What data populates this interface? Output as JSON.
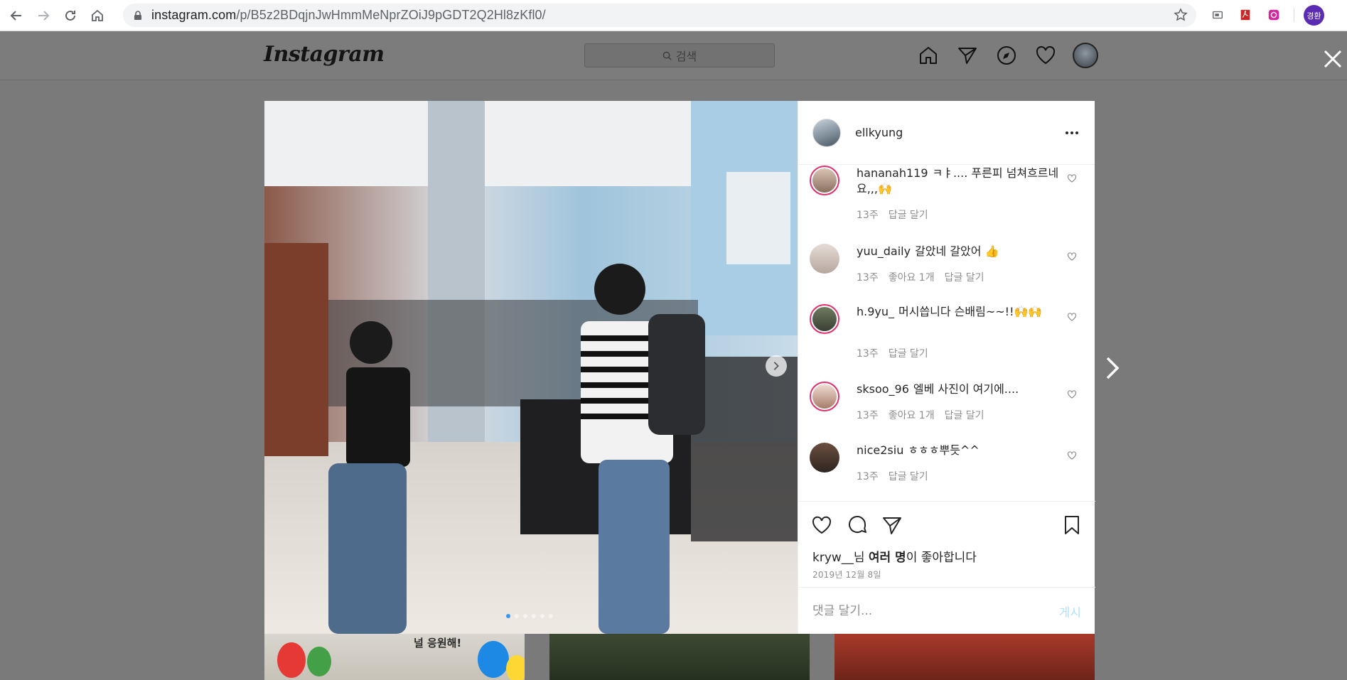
{
  "browser": {
    "url_host": "instagram.com",
    "url_path": "/p/B5z2BDqjnJwHmmMeNprZOiJ9pGDT2Q2Hl8zKfl0/",
    "profile_initials": "경환"
  },
  "topbar": {
    "logo": "Instagram",
    "search_placeholder": "검색"
  },
  "post": {
    "author": "ellkyung",
    "photo_count": 6,
    "active_photo_index": 0,
    "comments": [
      {
        "user": "hananah119",
        "text": "ㅋㅑ.... 푸른피 넘쳐흐르네요,,,🙌",
        "time": "13주",
        "likes": "",
        "reply": "답글 달기"
      },
      {
        "user": "yuu_daily",
        "text": "갈았네 갈았어 👍",
        "time": "13주",
        "likes": "좋아요 1개",
        "reply": "답글 달기"
      },
      {
        "user": "h.9yu_",
        "text": "머시씁니다 슨배림~~!!🙌🙌",
        "time": "13주",
        "likes": "",
        "reply": "답글 달기"
      },
      {
        "user": "sksoo_96",
        "text": "엘베 사진이 여기에....",
        "time": "13주",
        "likes": "좋아요 1개",
        "reply": "답글 달기"
      },
      {
        "user": "nice2siu",
        "text": "ㅎㅎㅎ뿌듯^^",
        "time": "13주",
        "likes": "",
        "reply": "답글 달기"
      }
    ],
    "likes_user": "kryw__",
    "likes_mid": "님 ",
    "likes_bold": "여러 명",
    "likes_tail": "이 좋아합니다",
    "date": "2019년 12월 8일",
    "comment_placeholder": "댓글 달기...",
    "post_button": "게시"
  },
  "grid": {
    "banner_text": "널 응원해!"
  },
  "colors": {
    "accent": "#3897f0",
    "post_button_disabled": "#b2dffc",
    "story_ring": "#e1306c",
    "overlay": "#7a7a7a"
  }
}
